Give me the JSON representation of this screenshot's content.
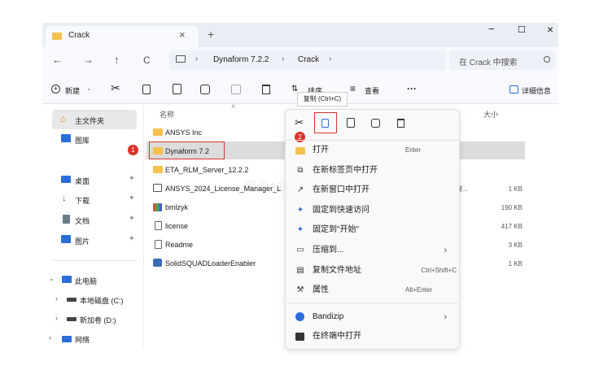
{
  "window": {
    "tab_title": "Crack",
    "tab_close": "×",
    "tab_add": "+",
    "win_min": "−",
    "win_max": "☐",
    "win_close": "×"
  },
  "address": {
    "back": "←",
    "forward": "→",
    "up": "↑",
    "refresh": "C",
    "crumb1": "Dynaform 7.2.2",
    "crumb2": "Crack",
    "sep": "›",
    "search_placeholder": "在 Crack 中搜索"
  },
  "toolbar": {
    "new_label": "新建",
    "more": "···",
    "sort_label": "排序",
    "view_label": "查看",
    "details_label": "详细信息"
  },
  "columns": {
    "name": "名称",
    "size": "大小"
  },
  "sidebar": {
    "home": "主文件夹",
    "gallery": "图库",
    "desktop": "桌面",
    "downloads": "下载",
    "documents": "文档",
    "pictures": "图片",
    "this_pc": "此电脑",
    "drive_c": "本地磁盘 (C:)",
    "drive_d": "新加卷 (D:)",
    "network": "网络"
  },
  "files": [
    {
      "name": "ANSYS Inc",
      "size": ""
    },
    {
      "name": "Dynaform 7.2",
      "size": ""
    },
    {
      "name": "ETA_RLM_Server_12.2.2",
      "size": ""
    },
    {
      "name": "ANSYS_2024_License_Manager_L",
      "size": "1 KB"
    },
    {
      "name": "bmlzyk",
      "size": "190 KB"
    },
    {
      "name": "license",
      "size": "417 KB"
    },
    {
      "name": "Readme",
      "size": "3 KB"
    },
    {
      "name": "SolidSQUADLoaderEnabler",
      "size": "1 KB"
    }
  ],
  "type_fragment": "理...",
  "tooltip": "复制 (Ctrl+C)",
  "badges": {
    "one": "1",
    "two": "2"
  },
  "context_menu": [
    {
      "label": "打开",
      "shortcut": "Enter"
    },
    {
      "label": "在新标签页中打开",
      "shortcut": ""
    },
    {
      "label": "在新窗口中打开",
      "shortcut": ""
    },
    {
      "label": "固定到快速访问",
      "shortcut": ""
    },
    {
      "label": "固定到\"开始\"",
      "shortcut": ""
    },
    {
      "label": "压缩到...",
      "shortcut": "›"
    },
    {
      "label": "复制文件地址",
      "shortcut": "Ctrl+Shift+C"
    },
    {
      "label": "属性",
      "shortcut": "Alt+Enter"
    },
    {
      "label": "Bandizip",
      "shortcut": "›"
    },
    {
      "label": "在终端中打开",
      "shortcut": ""
    }
  ],
  "watermark": "用户1105",
  "colors": {
    "accent": "#d9332b",
    "folder": "#f2c14e",
    "selected": "#dcdcdc"
  }
}
